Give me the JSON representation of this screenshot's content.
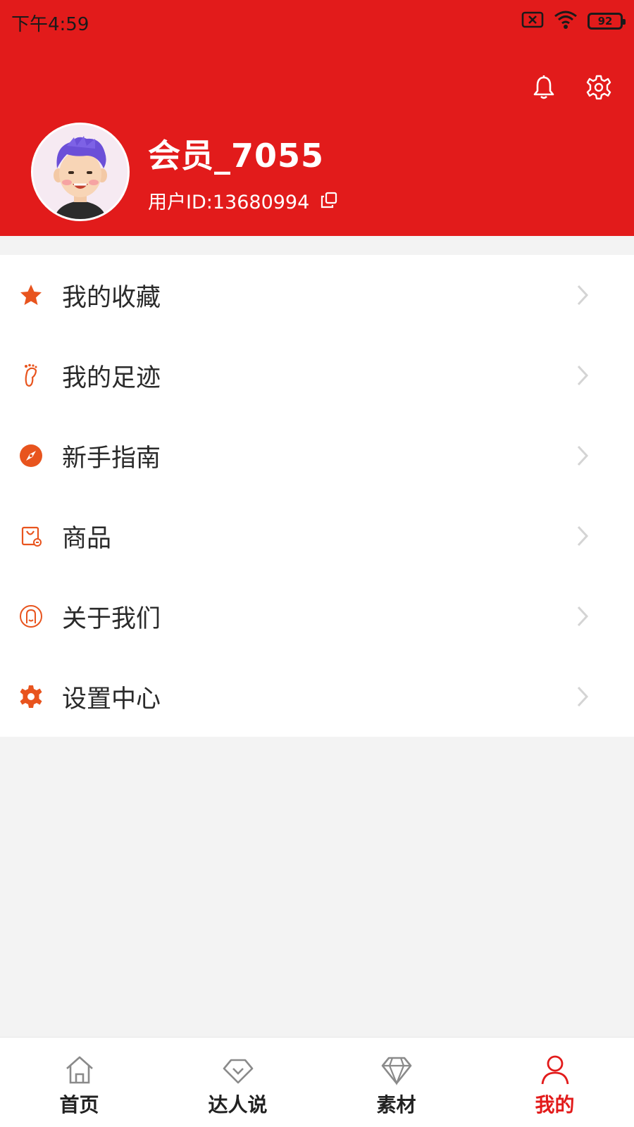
{
  "status_bar": {
    "time": "下午4:59",
    "battery": "92"
  },
  "header": {
    "nickname": "会员_7055",
    "user_id": "用户ID:13680994",
    "bg_color": "#e21b1b"
  },
  "menu": {
    "items": [
      {
        "label": "我的收藏",
        "icon": "star-icon"
      },
      {
        "label": "我的足迹",
        "icon": "footprint-icon"
      },
      {
        "label": "新手指南",
        "icon": "compass-icon"
      },
      {
        "label": "商品",
        "icon": "shopping-bag-icon"
      },
      {
        "label": "关于我们",
        "icon": "user-circle-icon"
      },
      {
        "label": "设置中心",
        "icon": "gear-icon"
      }
    ]
  },
  "bottom_nav": {
    "items": [
      {
        "label": "首页",
        "icon": "home-icon",
        "active": false
      },
      {
        "label": "达人说",
        "icon": "talk-icon",
        "active": false
      },
      {
        "label": "素材",
        "icon": "diamond-icon",
        "active": false
      },
      {
        "label": "我的",
        "icon": "person-icon",
        "active": true
      }
    ],
    "active_color": "#e21b1b"
  },
  "colors": {
    "accent": "#e21b1b",
    "menu_icon": "#e8541e"
  }
}
